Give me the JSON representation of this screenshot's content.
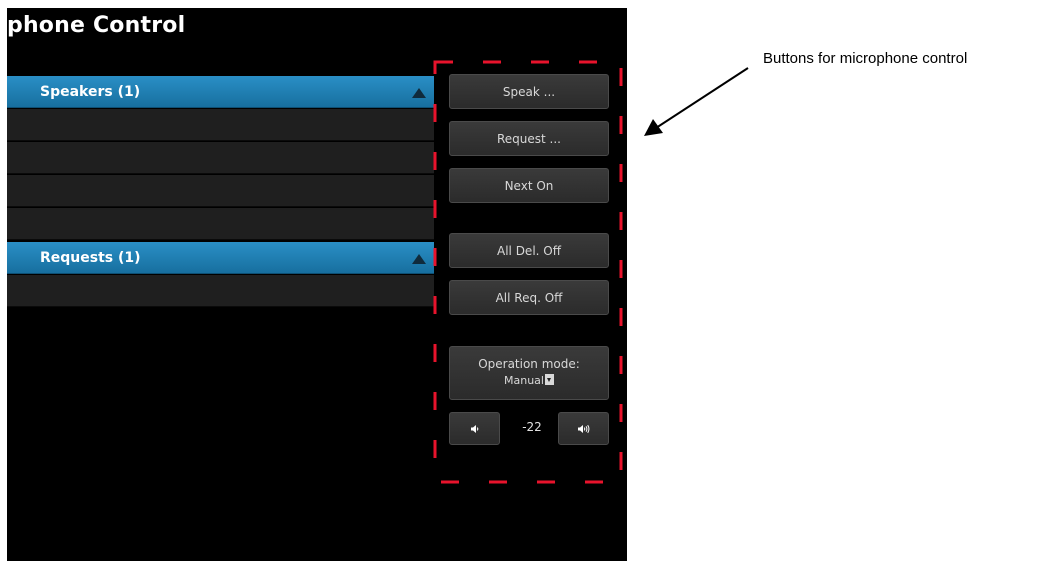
{
  "page": {
    "title": "phone Control"
  },
  "speakers": {
    "header": "Speakers (1)"
  },
  "requests": {
    "header": "Requests (1)"
  },
  "controls": {
    "speak": "Speak ...",
    "request": "Request ...",
    "next_on": "Next On",
    "all_del_off": "All Del. Off",
    "all_req_off": "All Req. Off",
    "operation_mode_label": "Operation mode:",
    "operation_mode_value": "Manual",
    "volume_value": "-22"
  },
  "annotation": {
    "text": "Buttons for microphone control"
  },
  "colors": {
    "background": "#000000",
    "header_blue": "#1d7db3",
    "button_gray": "#333333",
    "highlight_red": "#e8132c"
  },
  "icons": {
    "collapse": "triangle-up-icon",
    "volume_down": "speaker-low-icon",
    "volume_up": "speaker-high-icon",
    "dropdown": "dropdown-icon"
  }
}
